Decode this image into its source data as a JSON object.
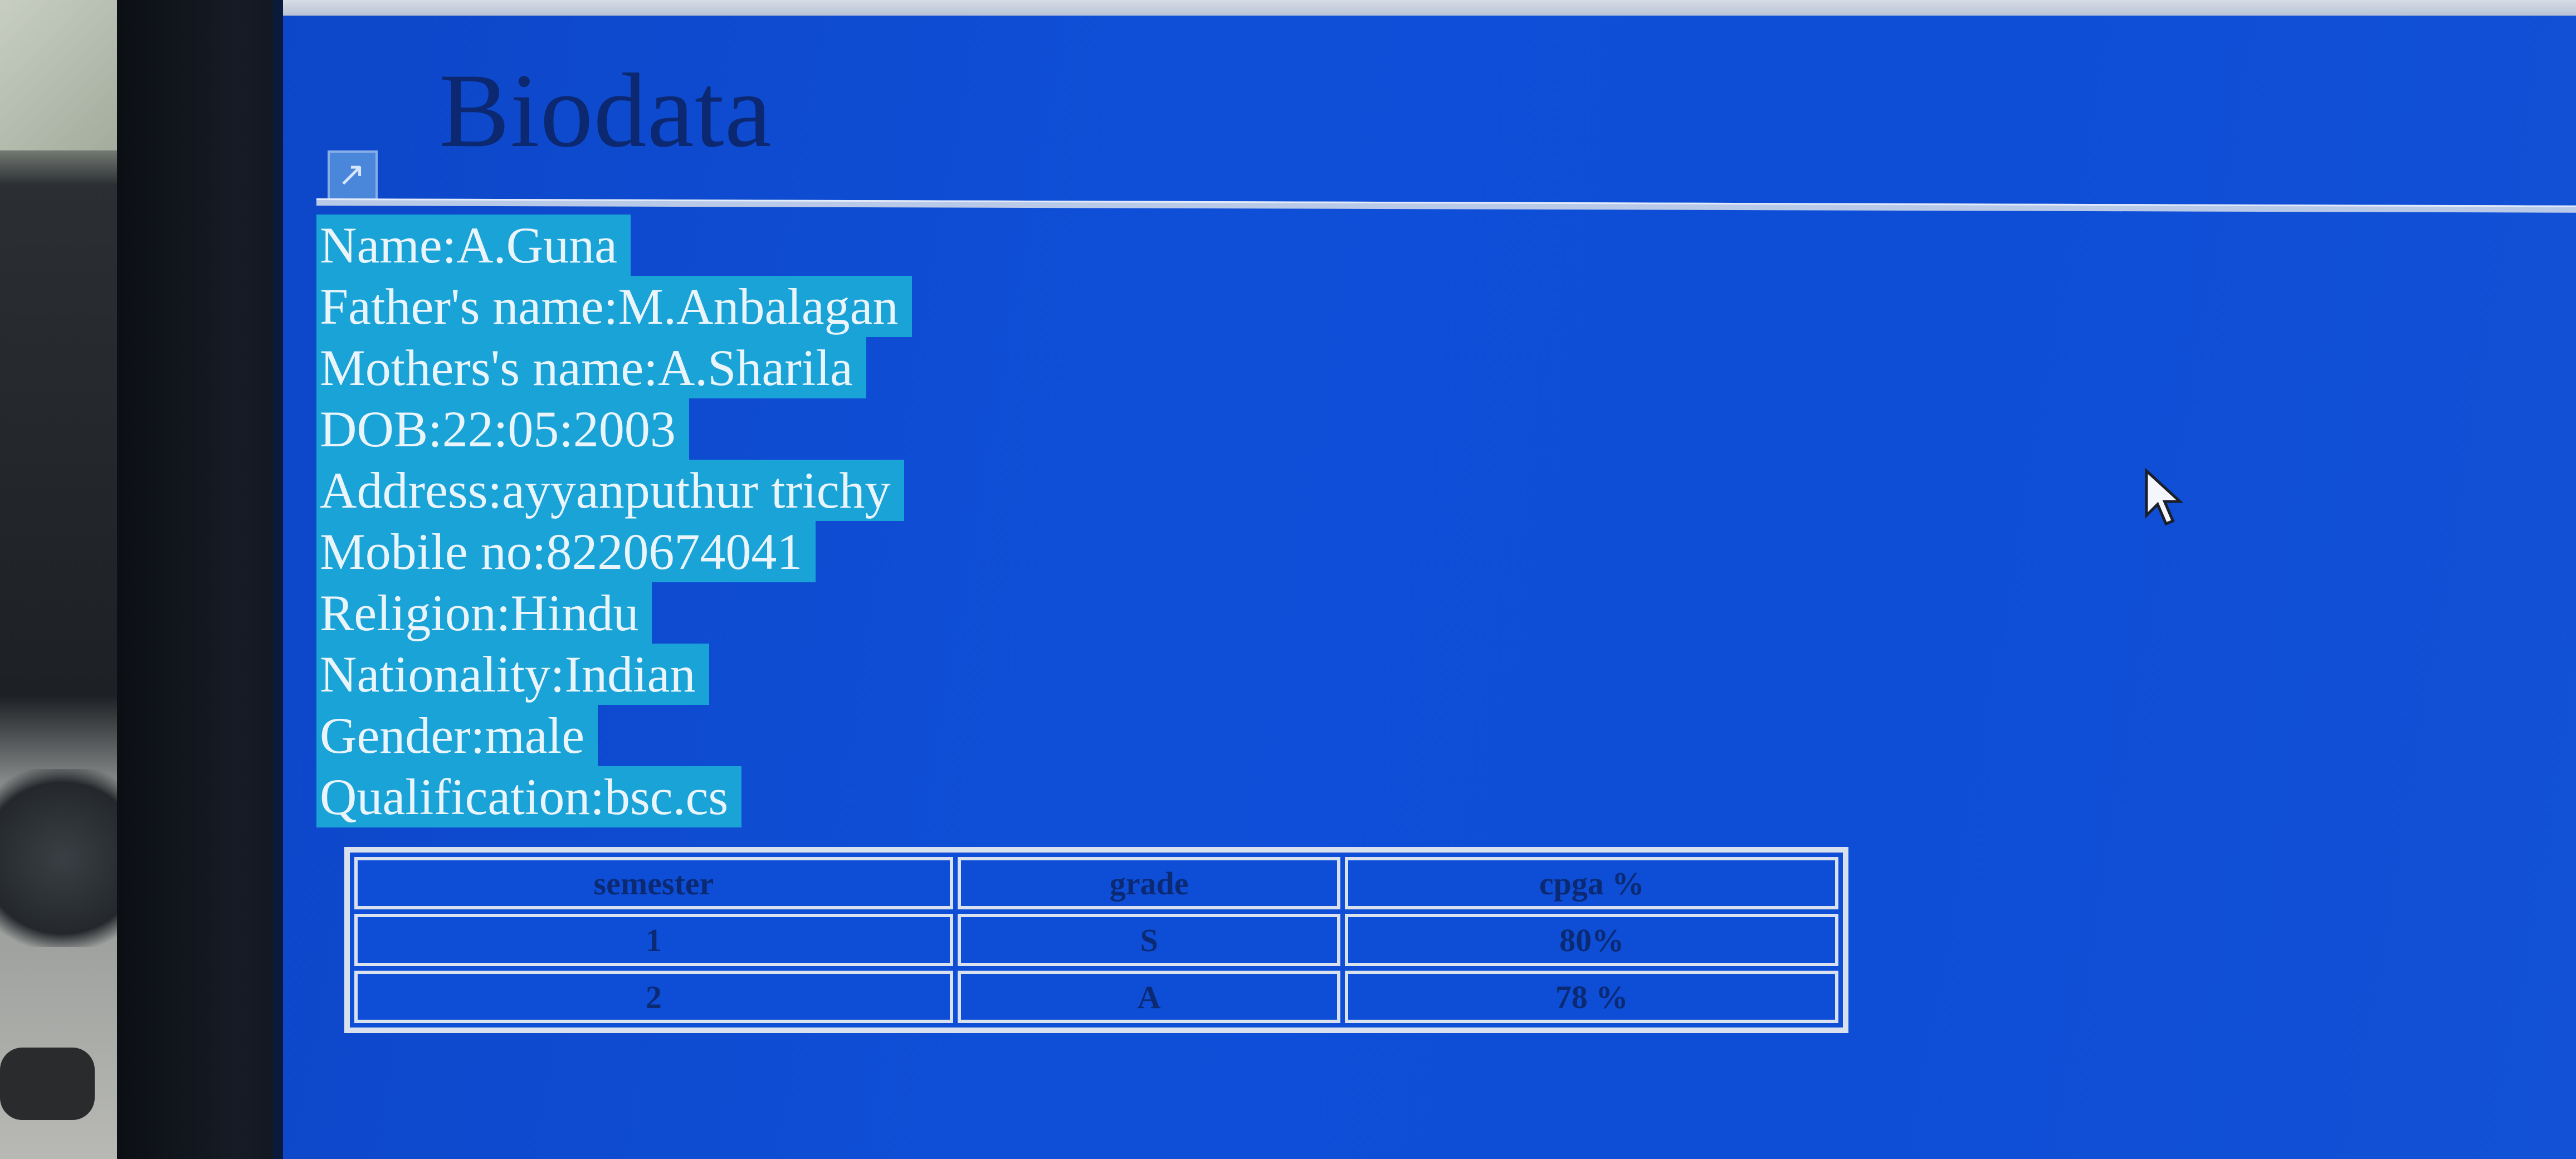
{
  "page": {
    "title": "Biodata"
  },
  "bio": [
    {
      "label": "Name:",
      "value": "A.Guna"
    },
    {
      "label": "Father's name:",
      "value": "M.Anbalagan"
    },
    {
      "label": "Mothers's name:",
      "value": "A.Sharila"
    },
    {
      "label": "DOB:",
      "value": "22:05:2003"
    },
    {
      "label": "Address:",
      "value": "ayyanputhur trichy"
    },
    {
      "label": "Mobile no:",
      "value": "8220674041"
    },
    {
      "label": "Religion:",
      "value": "Hindu"
    },
    {
      "label": "Nationality:",
      "value": "Indian"
    },
    {
      "label": "Gender:",
      "value": "male"
    },
    {
      "label": "Qualification:",
      "value": "bsc.cs"
    }
  ],
  "table": {
    "headers": [
      "semester",
      "grade",
      "cpga %"
    ],
    "rows": [
      [
        "1",
        "S",
        "80%"
      ],
      [
        "2",
        "A",
        "78 %"
      ]
    ]
  },
  "colors": {
    "page_background": "#0e4dd6",
    "selection_highlight": "#1aa3d6",
    "title_text": "#0c2870",
    "table_text": "#0b2a73"
  },
  "icons": {
    "broken_image": "broken-image-icon",
    "cursor": "mouse-pointer-icon"
  }
}
